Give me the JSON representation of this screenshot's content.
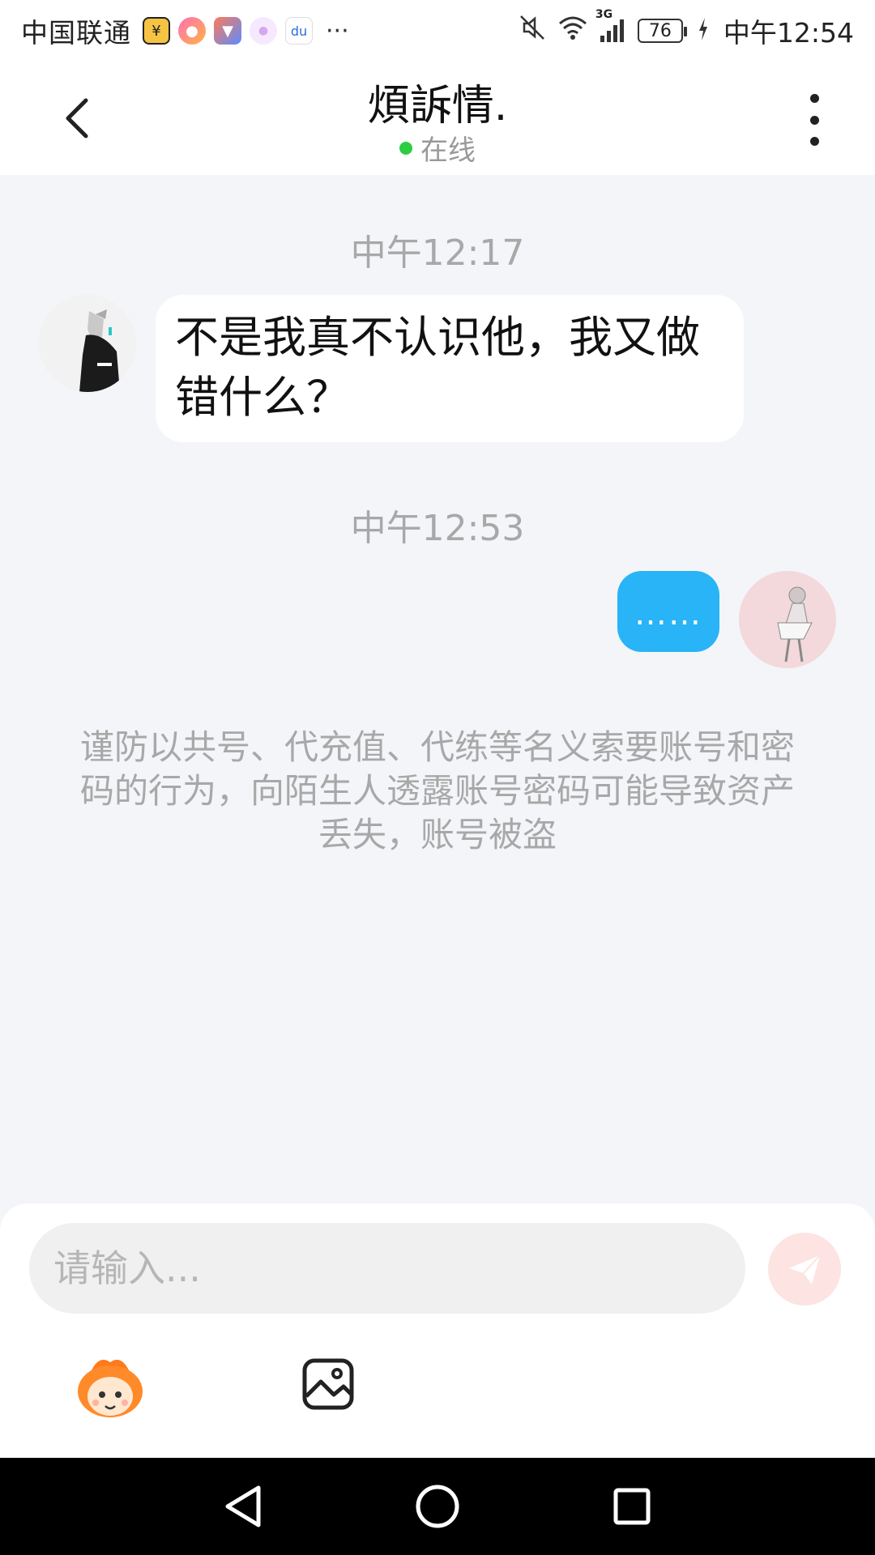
{
  "status_bar": {
    "carrier": "中国联通",
    "app_icons": [
      "coin-app-icon",
      "candy-app-icon",
      "flag-app-icon",
      "cat-app-icon",
      "baidu-app-icon"
    ],
    "more": "···",
    "network": "3G",
    "battery": "76",
    "time": "中午12:54"
  },
  "header": {
    "title": "煩訴情.",
    "status": "在线",
    "status_color": "#2ecc40"
  },
  "chat": {
    "messages": [
      {
        "timestamp": "中午12:17",
        "direction": "incoming",
        "text": "不是我真不认识他，我又做错什么？"
      },
      {
        "timestamp": "中午12:53",
        "direction": "outgoing",
        "text": "……"
      }
    ],
    "notice": "谨防以共号、代充值、代练等名义索要账号和密码的行为，向陌生人透露账号密码可能导致资产丢失，账号被盗"
  },
  "input": {
    "placeholder": "请输入...",
    "value": "",
    "send_icon": "send-icon"
  },
  "toolbar": {
    "emoji_icon": "emoji-mascot-icon",
    "image_icon": "image-icon"
  },
  "nav": {
    "back": "triangle-back-icon",
    "home": "circle-home-icon",
    "recents": "square-recents-icon"
  },
  "colors": {
    "outgoing_bubble": "#28b4f6",
    "incoming_bubble": "#ffffff",
    "background": "#f3f5f8",
    "send_button": "#fde3e2"
  }
}
